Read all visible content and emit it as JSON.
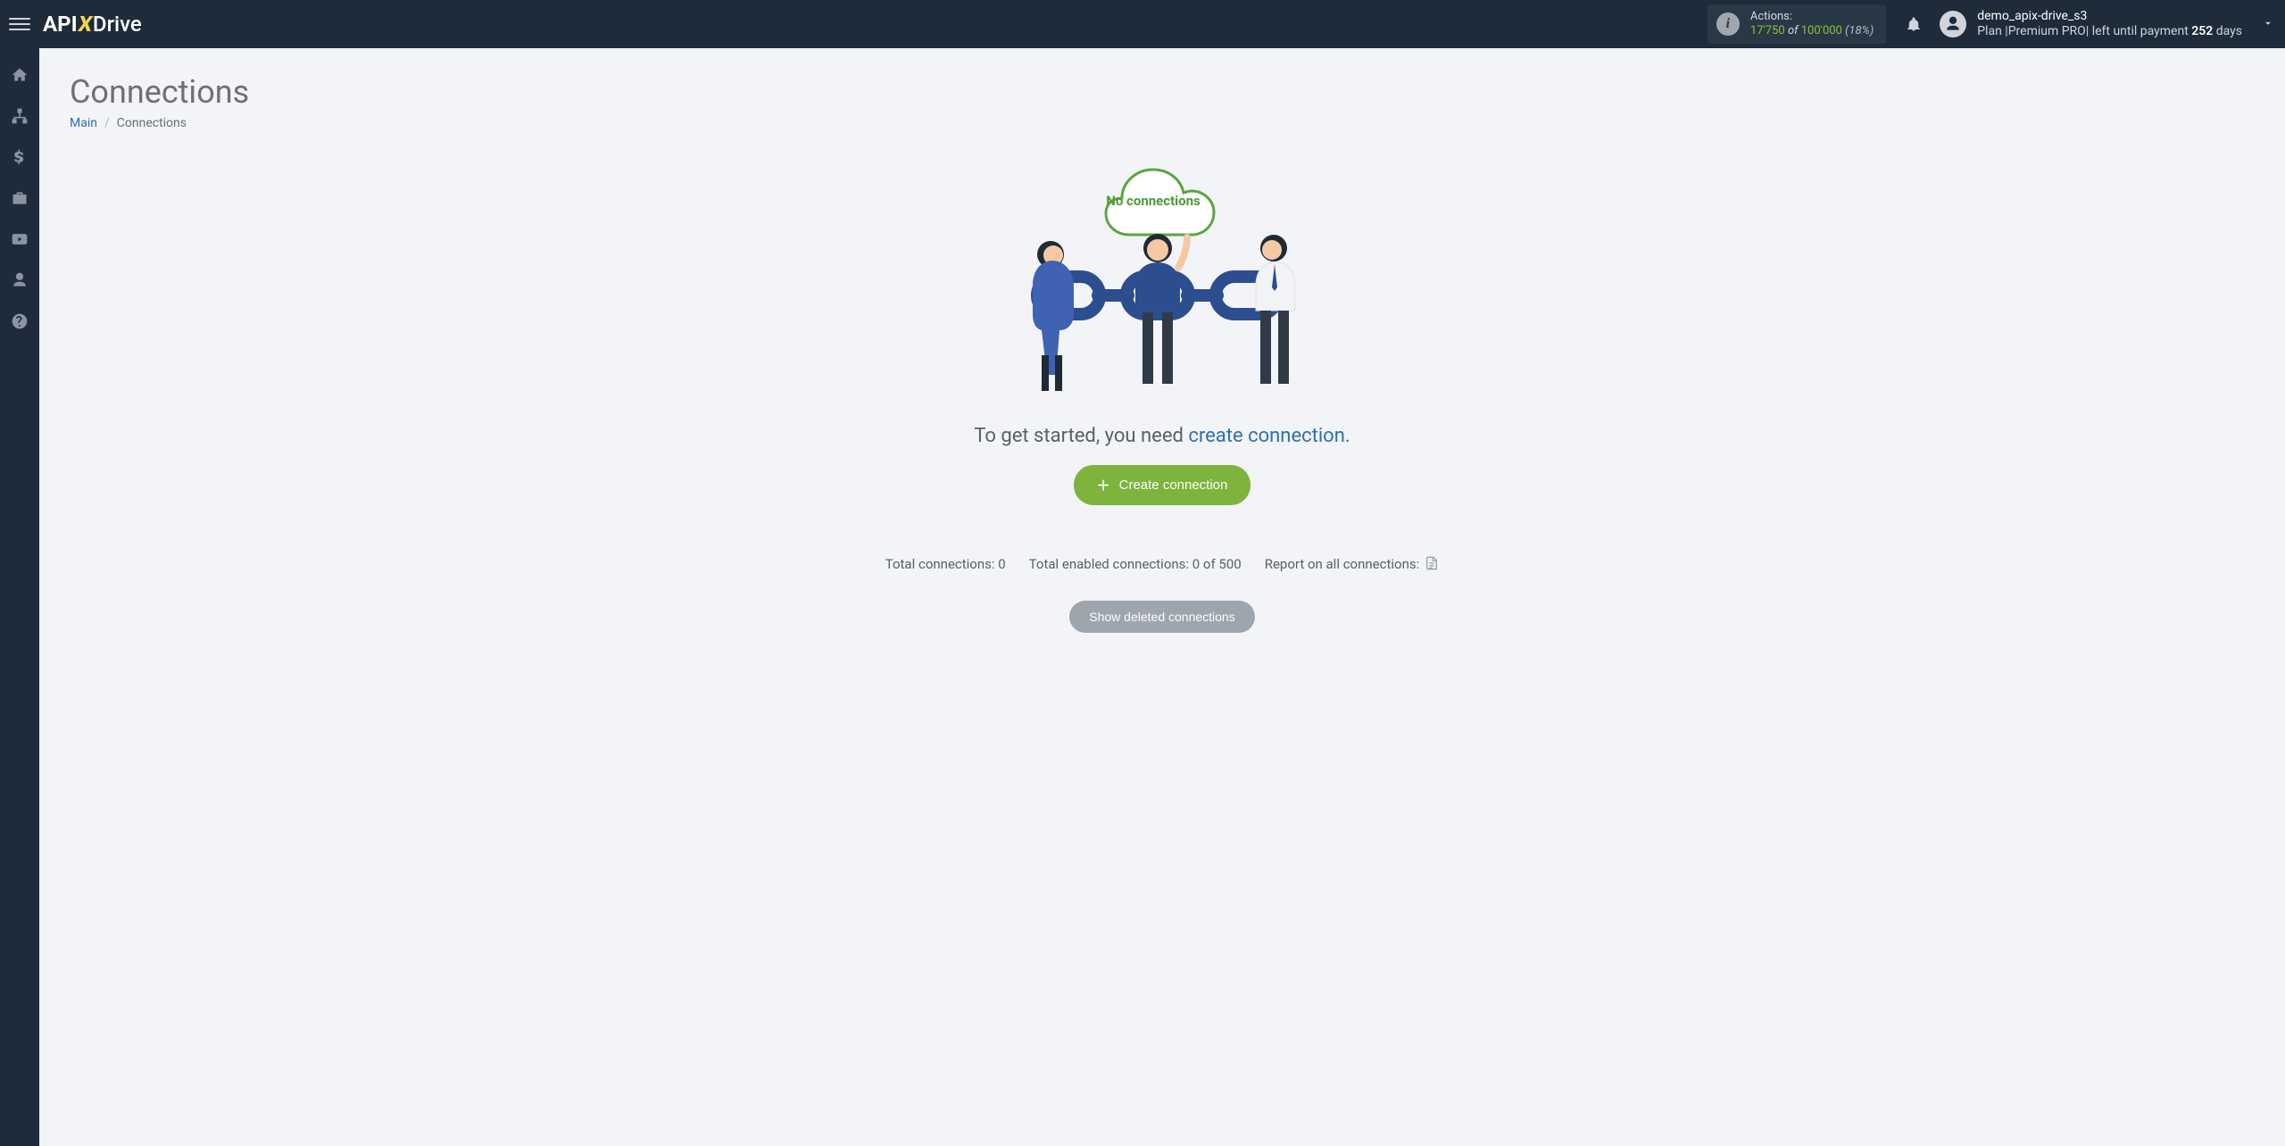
{
  "header": {
    "logo": {
      "api": "API",
      "x": "X",
      "drive": "Drive"
    },
    "actions": {
      "label": "Actions:",
      "used": "17'750",
      "of_word": "of",
      "limit": "100'000",
      "percent": "(18%)"
    },
    "user": {
      "name": "demo_apix-drive_s3",
      "plan_prefix": "Plan |",
      "plan_name": "Premium PRO",
      "plan_mid": "| left until payment ",
      "days": "252",
      "plan_suffix": " days"
    }
  },
  "sidebar": {
    "items": [
      {
        "key": "home"
      },
      {
        "key": "connections"
      },
      {
        "key": "billing"
      },
      {
        "key": "marketplace"
      },
      {
        "key": "videos"
      },
      {
        "key": "account"
      },
      {
        "key": "help"
      }
    ]
  },
  "page": {
    "title": "Connections",
    "breadcrumb": {
      "main": "Main",
      "current": "Connections"
    },
    "cloud_text": "No connections",
    "lead_prefix": "To get started, you need ",
    "lead_link": "create connection",
    "lead_suffix": ".",
    "create_btn": "Create connection",
    "stats": {
      "total_label": "Total connections: ",
      "total_value": "0",
      "enabled_label": "Total enabled connections: ",
      "enabled_value": "0 of 500",
      "report_label": "Report on all connections:"
    },
    "show_deleted_btn": "Show deleted connections"
  }
}
